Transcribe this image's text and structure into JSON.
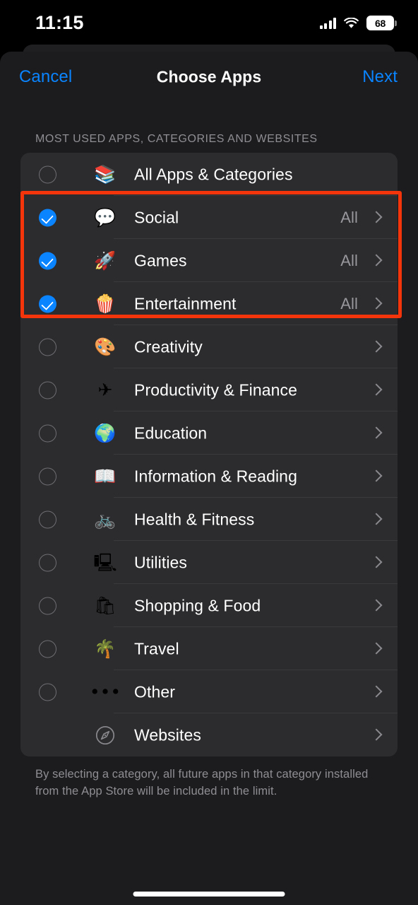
{
  "status_bar": {
    "time": "11:15",
    "cellular_icon": "cellular-signal-icon",
    "wifi_icon": "wifi-icon",
    "battery_percent": "68",
    "battery_icon": "battery-icon"
  },
  "navbar": {
    "cancel_label": "Cancel",
    "title": "Choose Apps",
    "next_label": "Next"
  },
  "section": {
    "header": "MOST USED APPS, CATEGORIES AND WEBSITES"
  },
  "colors": {
    "accent_blue": "#0a84ff",
    "annotation_red": "#f4340b",
    "page_background": "#1c1c1e",
    "card_background": "#2c2c2e",
    "secondary_text": "#8e8e93"
  },
  "annotation": {
    "type": "red-highlight-box",
    "covers_rows": [
      "Social",
      "Games",
      "Entertainment"
    ]
  },
  "rows": [
    {
      "label": "All Apps & Categories",
      "icon": "stack-layers-icon",
      "emoji": "📚",
      "checkbox": "unchecked",
      "trailing_value": "",
      "has_chevron": false,
      "has_checkbox": true,
      "highlighted": false
    },
    {
      "label": "Social",
      "icon": "speech-bubble-heart-icon",
      "emoji": "💬",
      "checkbox": "checked",
      "trailing_value": "All",
      "has_chevron": true,
      "has_checkbox": true,
      "highlighted": true
    },
    {
      "label": "Games",
      "icon": "rocket-icon",
      "emoji": "🚀",
      "checkbox": "checked",
      "trailing_value": "All",
      "has_chevron": true,
      "has_checkbox": true,
      "highlighted": true
    },
    {
      "label": "Entertainment",
      "icon": "popcorn-icon",
      "emoji": "🍿",
      "checkbox": "checked",
      "trailing_value": "All",
      "has_chevron": true,
      "has_checkbox": true,
      "highlighted": true
    },
    {
      "label": "Creativity",
      "icon": "artist-palette-icon",
      "emoji": "🎨",
      "checkbox": "unchecked",
      "trailing_value": "",
      "has_chevron": true,
      "has_checkbox": true,
      "highlighted": false
    },
    {
      "label": "Productivity & Finance",
      "icon": "paper-plane-icon",
      "emoji": "✈",
      "checkbox": "unchecked",
      "trailing_value": "",
      "has_chevron": true,
      "has_checkbox": true,
      "highlighted": false
    },
    {
      "label": "Education",
      "icon": "globe-stand-icon",
      "emoji": "🌍",
      "checkbox": "unchecked",
      "trailing_value": "",
      "has_chevron": true,
      "has_checkbox": true,
      "highlighted": false
    },
    {
      "label": "Information & Reading",
      "icon": "open-book-icon",
      "emoji": "📖",
      "checkbox": "unchecked",
      "trailing_value": "",
      "has_chevron": true,
      "has_checkbox": true,
      "highlighted": false
    },
    {
      "label": "Health & Fitness",
      "icon": "bicycle-icon",
      "emoji": "🚲",
      "checkbox": "unchecked",
      "trailing_value": "",
      "has_chevron": true,
      "has_checkbox": true,
      "highlighted": false
    },
    {
      "label": "Utilities",
      "icon": "calculator-icon",
      "emoji": "🖳",
      "checkbox": "unchecked",
      "trailing_value": "",
      "has_chevron": true,
      "has_checkbox": true,
      "highlighted": false
    },
    {
      "label": "Shopping & Food",
      "icon": "shopping-bag-icon",
      "emoji": "🛍",
      "checkbox": "unchecked",
      "trailing_value": "",
      "has_chevron": true,
      "has_checkbox": true,
      "highlighted": false
    },
    {
      "label": "Travel",
      "icon": "palm-tree-beach-icon",
      "emoji": "🌴",
      "checkbox": "unchecked",
      "trailing_value": "",
      "has_chevron": true,
      "has_checkbox": true,
      "highlighted": false
    },
    {
      "label": "Other",
      "icon": "ellipsis-icon",
      "emoji": "•••",
      "checkbox": "unchecked",
      "trailing_value": "",
      "has_chevron": true,
      "has_checkbox": true,
      "highlighted": false
    },
    {
      "label": "Websites",
      "icon": "compass-safari-icon",
      "emoji": "",
      "checkbox": "none",
      "trailing_value": "",
      "has_chevron": true,
      "has_checkbox": false,
      "highlighted": false
    }
  ],
  "footer": {
    "note": "By selecting a category, all future apps in that category installed from the App Store will be included in the limit."
  },
  "home_indicator": "home-indicator"
}
